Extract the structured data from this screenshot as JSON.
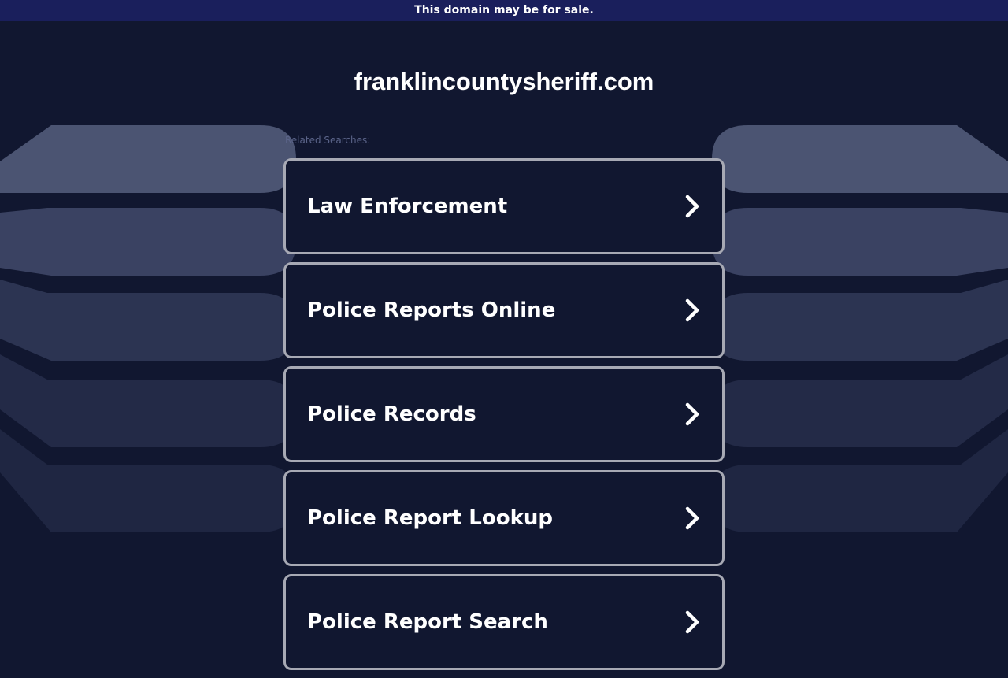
{
  "banner": {
    "text": "This domain may be for sale."
  },
  "domain": {
    "name": "franklincountysheriff.com"
  },
  "related": {
    "label": "Related Searches:"
  },
  "links": [
    {
      "label": "Law Enforcement",
      "icon": "chevron-right-icon"
    },
    {
      "label": "Police Reports Online",
      "icon": "chevron-right-icon"
    },
    {
      "label": "Police Records",
      "icon": "chevron-right-icon"
    },
    {
      "label": "Police Report Lookup",
      "icon": "chevron-right-icon"
    },
    {
      "label": "Police Report Search",
      "icon": "chevron-right-icon"
    }
  ],
  "colors": {
    "background": "#111730",
    "banner": "#1a1f5c",
    "card_border": "#a7a9b4",
    "text": "#ffffff",
    "muted_text": "#5b6489"
  }
}
